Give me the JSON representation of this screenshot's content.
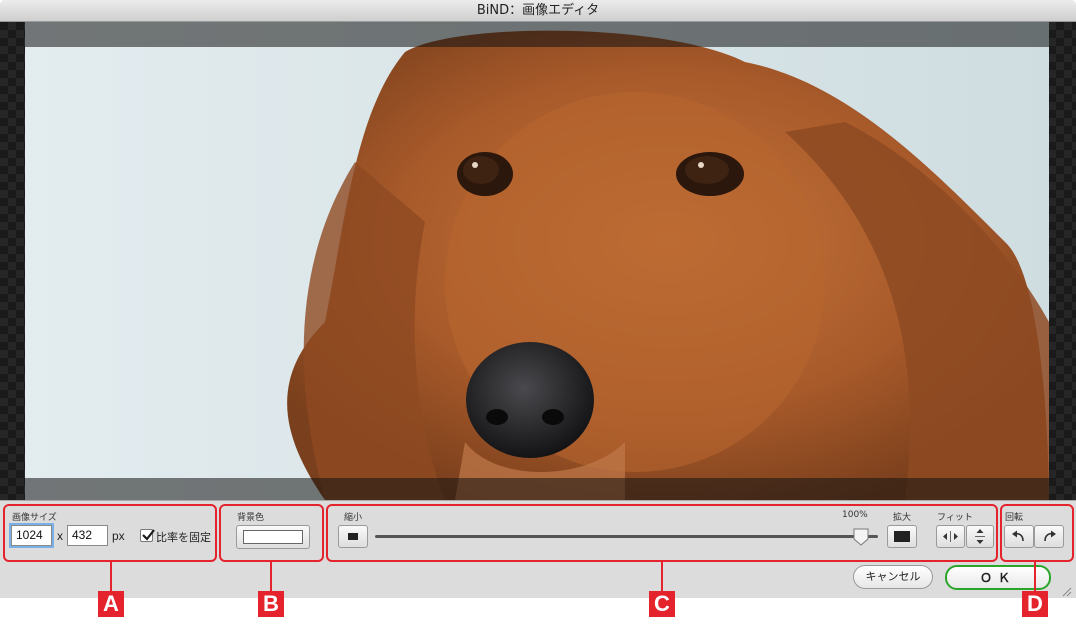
{
  "window": {
    "title": "BiND：画像エディタ"
  },
  "image_size": {
    "label": "画像サイズ",
    "width_value": "1024",
    "height_value": "432",
    "separator": "x",
    "unit": "px",
    "lock_ratio_label": "比率を固定",
    "lock_ratio_checked": true
  },
  "background_color": {
    "label": "背景色",
    "color": "#ffffff"
  },
  "zoom": {
    "shrink_label": "縮小",
    "enlarge_label": "拡大",
    "percent_label": "100%",
    "fit_label": "フィット",
    "level": 1.0
  },
  "rotate": {
    "label": "回転"
  },
  "footer": {
    "cancel_label": "キャンセル",
    "ok_label": "ＯＫ"
  },
  "markers": [
    "A",
    "B",
    "C",
    "D"
  ],
  "colors": {
    "highlight_border": "#e4232d",
    "ok_border": "#2aa52a"
  }
}
